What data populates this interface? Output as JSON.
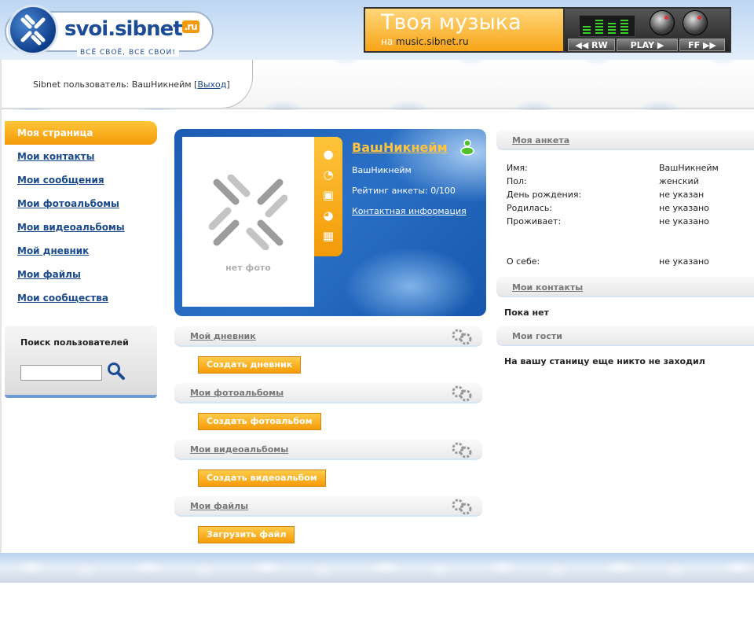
{
  "header": {
    "logo_text": "svoi.sibnet",
    "logo_ru": ".ru",
    "slogan": "ВСЁ СВОЁ, ВСЕ СВОИ!",
    "user_prefix": "Sibnet пользователь: ВашНикнейм [",
    "logout": "Выход",
    "user_suffix": "]"
  },
  "music_banner": {
    "title": "Твоя музыка",
    "sub_prefix": "на",
    "site": "music.sibnet.ru",
    "rw": "◀◀ RW",
    "play": "PLAY ▶",
    "ff": "FF ▶▶"
  },
  "nav": {
    "items": [
      {
        "label": "Моя страница"
      },
      {
        "label": "Мои контакты"
      },
      {
        "label": "Мои сообщения"
      },
      {
        "label": "Мои фотоальбомы"
      },
      {
        "label": "Мои видеоальбомы"
      },
      {
        "label": "Мой дневник"
      },
      {
        "label": "Мои файлы"
      },
      {
        "label": "Мои сообщества"
      }
    ]
  },
  "search": {
    "title": "Поиск пользователей",
    "value": ""
  },
  "profile": {
    "name": "ВашНикнейм",
    "nickname": "ВашНикнейм",
    "rating": "Рейтинг анкеты: 0/100",
    "contact_link": "Контактная информация",
    "no_photo": "нет фото"
  },
  "sections": [
    {
      "title": "Мой дневник",
      "button": "Создать дневник"
    },
    {
      "title": "Мои фотоальбомы",
      "button": "Создать фотоальбом"
    },
    {
      "title": "Мои видеоальбомы",
      "button": "Создать видеоальбом"
    },
    {
      "title": "Мои файлы",
      "button": "Загрузить файл"
    }
  ],
  "anketa": {
    "title": "Моя анкета",
    "rows": [
      {
        "key": "Имя:",
        "value": "ВашНикнейм"
      },
      {
        "key": "Пол:",
        "value": "женский"
      },
      {
        "key": "День рождения:",
        "value": "не указан"
      },
      {
        "key": "Родилась:",
        "value": "не указано"
      },
      {
        "key": "Проживает:",
        "value": "не указано"
      },
      {
        "key": "О себе:",
        "value": "не указано"
      }
    ]
  },
  "contacts": {
    "title": "Мои контакты",
    "empty": "Пока нет"
  },
  "guests": {
    "title": "Мои гости",
    "empty": "На вашу станицу еще никто не заходил"
  },
  "colors": {
    "accent_orange": "#f39a07",
    "brand_blue": "#1c5cb3",
    "link_blue": "#1a4a8c"
  }
}
